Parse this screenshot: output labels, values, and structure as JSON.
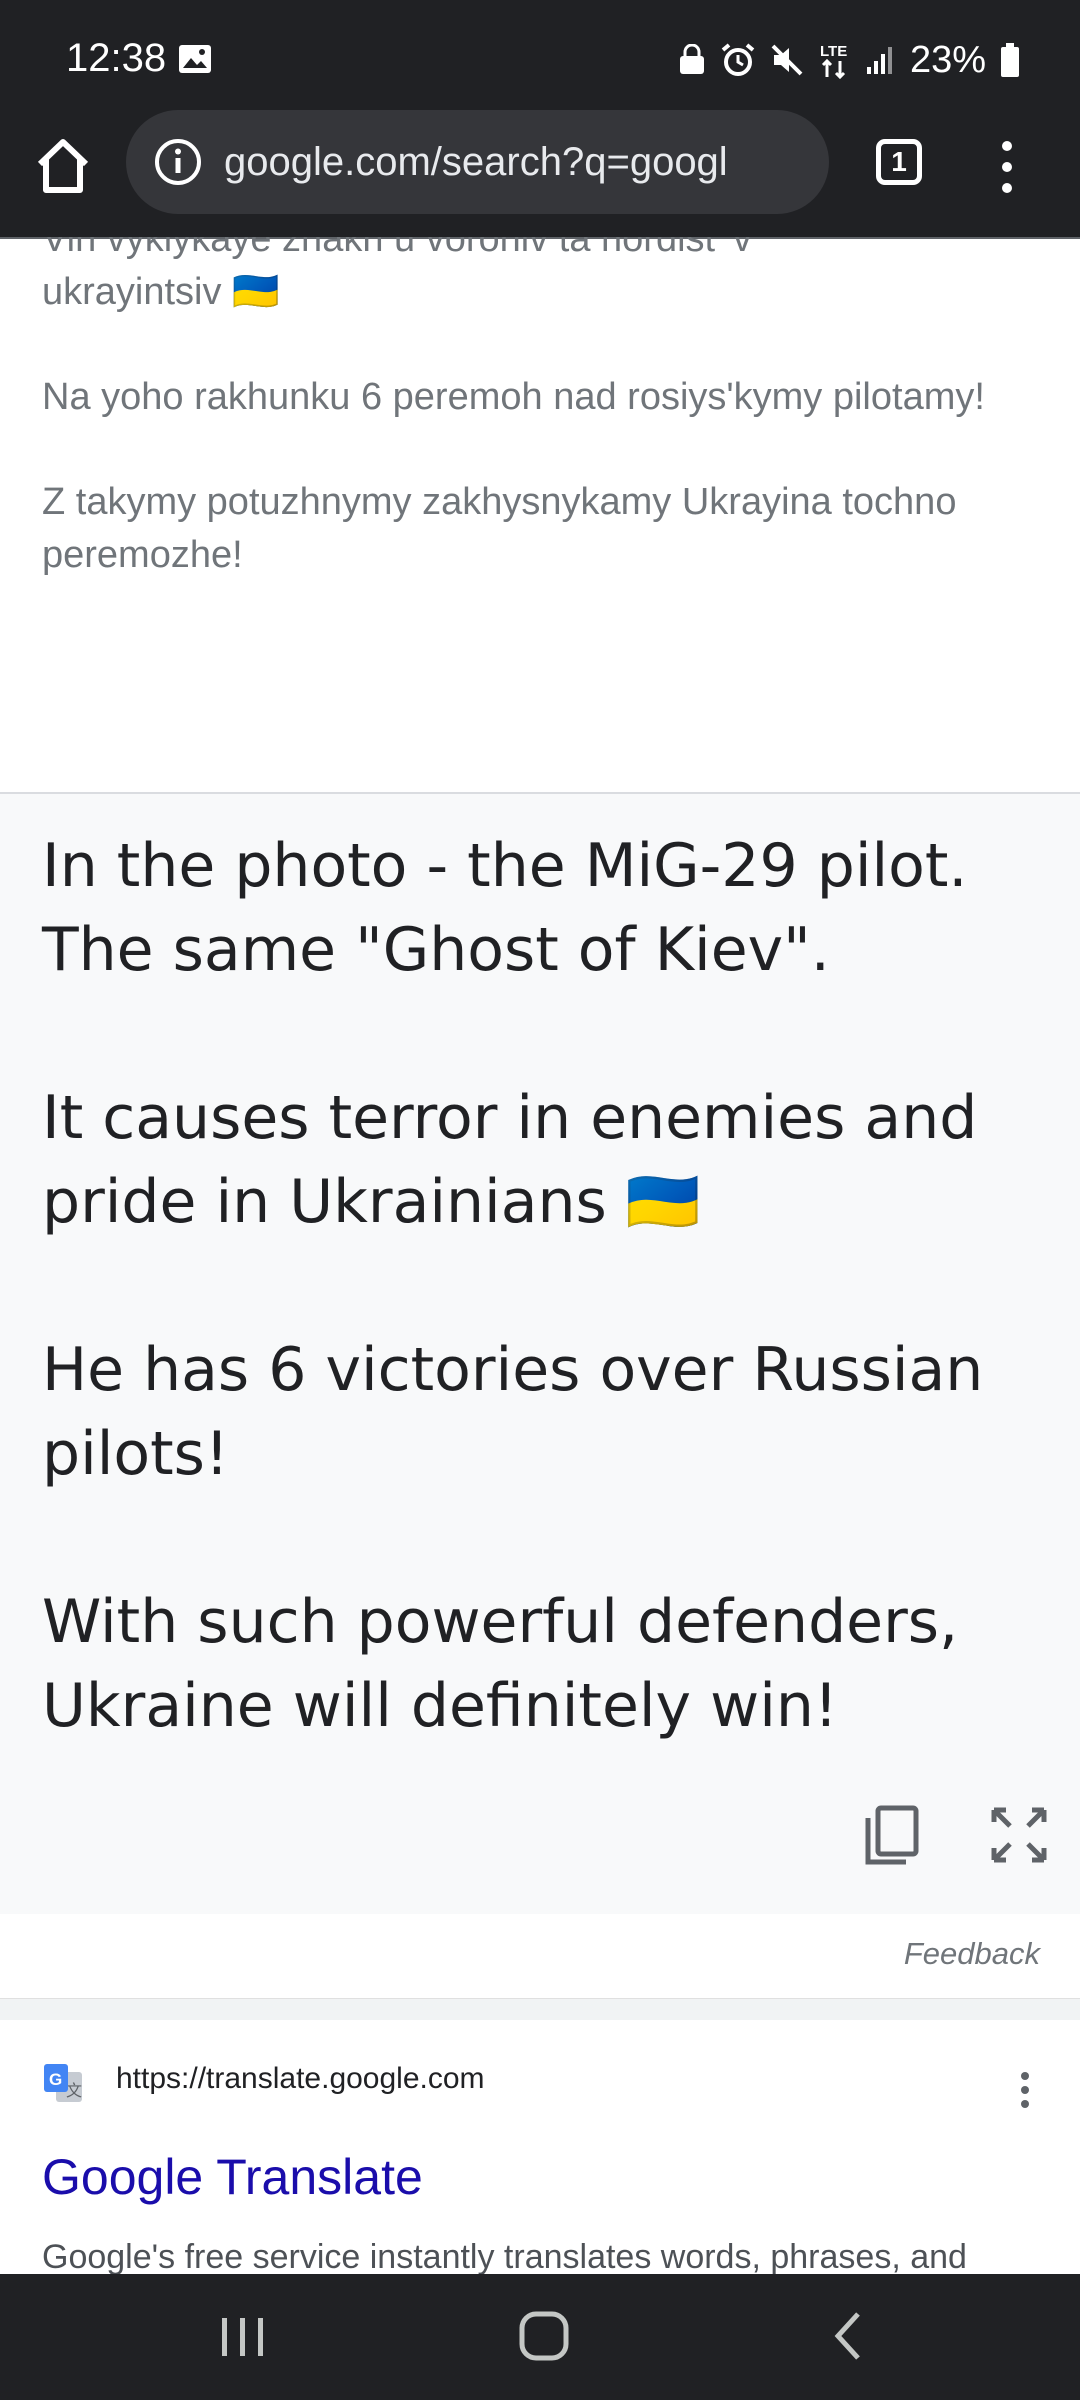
{
  "status_bar": {
    "time": "12:38",
    "battery_percent": "23%"
  },
  "browser": {
    "url": "google.com/search?q=googl",
    "tab_count": "1"
  },
  "original_text": {
    "partial_line": "Vin vyklykaye zhakh u vorohiv ta hordist' v",
    "paragraphs": [
      "ukrayintsiv 🇺🇦",
      "Na yoho rakhunku 6 peremoh nad rosiysʹkymy pilotamy!",
      "Z takymy potuzhnymy zakhysnykamy Ukrayina tochno peremozhe!"
    ]
  },
  "translation": {
    "paragraphs": [
      "In the photo - the MiG-29 pilot. The same \"Ghost of Kiev\".",
      "It causes terror in enemies and pride in Ukrainians 🇺🇦",
      "He has 6 victories over Russian pilots!",
      "With such powerful defenders, Ukraine will definitely win!"
    ]
  },
  "feedback_label": "Feedback",
  "result": {
    "url": "https://translate.google.com",
    "title": "Google Translate",
    "snippet": "Google's free service instantly translates words, phrases, and"
  },
  "colors": {
    "system_bar": "#202124",
    "url_pill": "#35363a",
    "link_blue": "#1a0dab",
    "translation_bg": "#f8f9fa"
  }
}
